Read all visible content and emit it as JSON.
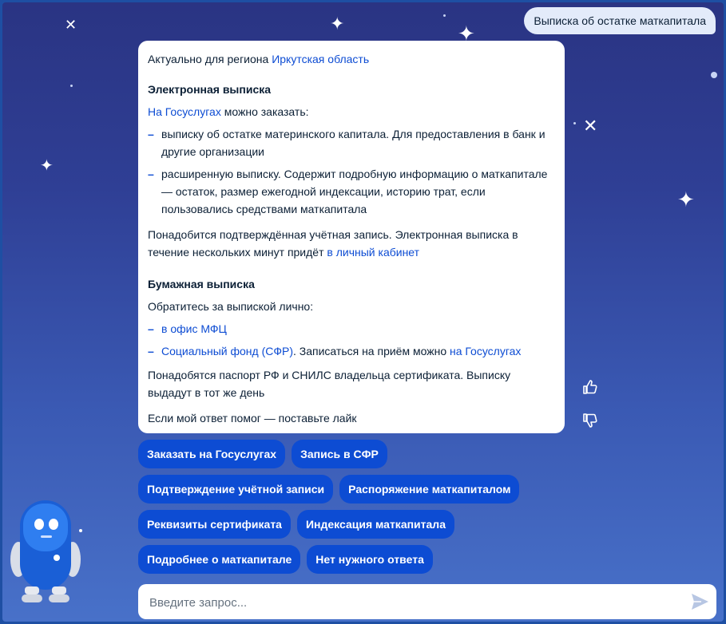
{
  "user_message": "Выписка об остатке маткапитала",
  "bot_message": {
    "region_prefix": "Актуально для региона ",
    "region_link": "Иркутская область",
    "section1_title": "Электронная выписка",
    "order_link": "На Госуслугах",
    "order_text": " можно заказать:",
    "list1": [
      "выписку об остатке материнского капитала. Для предоставления в банк и другие организации",
      "расширенную выписку. Содержит подробную информацию о маткапитале — остаток, размер ежегодной индексации, историю трат, если пользовались средствами маткапитала"
    ],
    "account_text": "Понадобится подтверждённая учётная запись. Электронная выписка в течение нескольких минут придёт ",
    "cabinet_link": "в личный кабинет",
    "section2_title": "Бумажная выписка",
    "paper_intro": "Обратитесь за выпиской лично:",
    "mfc_link": "в офис МФЦ",
    "sfr_link": "Социальный фонд (СФР)",
    "sfr_text": ". Записаться на приём можно ",
    "sfr_gosuslugi_link": "на Госуслугах",
    "documents_text": "Понадобятся паспорт РФ и СНИЛС владельца сертификата. Выписку выдадут в тот же день",
    "like_prompt": "Если мой ответ помог — поставьте лайк"
  },
  "chips": [
    [
      "Заказать на Госуслугах",
      "Запись в СФР"
    ],
    [
      "Подтверждение учётной записи",
      "Распоряжение маткапиталом"
    ],
    [
      "Реквизиты сертификата",
      "Индексация маткапитала"
    ],
    [
      "Подробнее о маткапитале",
      "Нет нужного ответа"
    ]
  ],
  "input": {
    "placeholder": "Введите запрос..."
  },
  "icons": {
    "like": "thumb-up-icon",
    "dislike": "thumb-down-icon",
    "send": "send-icon",
    "avatar": "robot-assistant-avatar"
  },
  "colors": {
    "accent": "#0d4cd3",
    "background_top": "#2a3483",
    "background_bottom": "#4871c9",
    "user_bubble": "#e3ebfa"
  }
}
